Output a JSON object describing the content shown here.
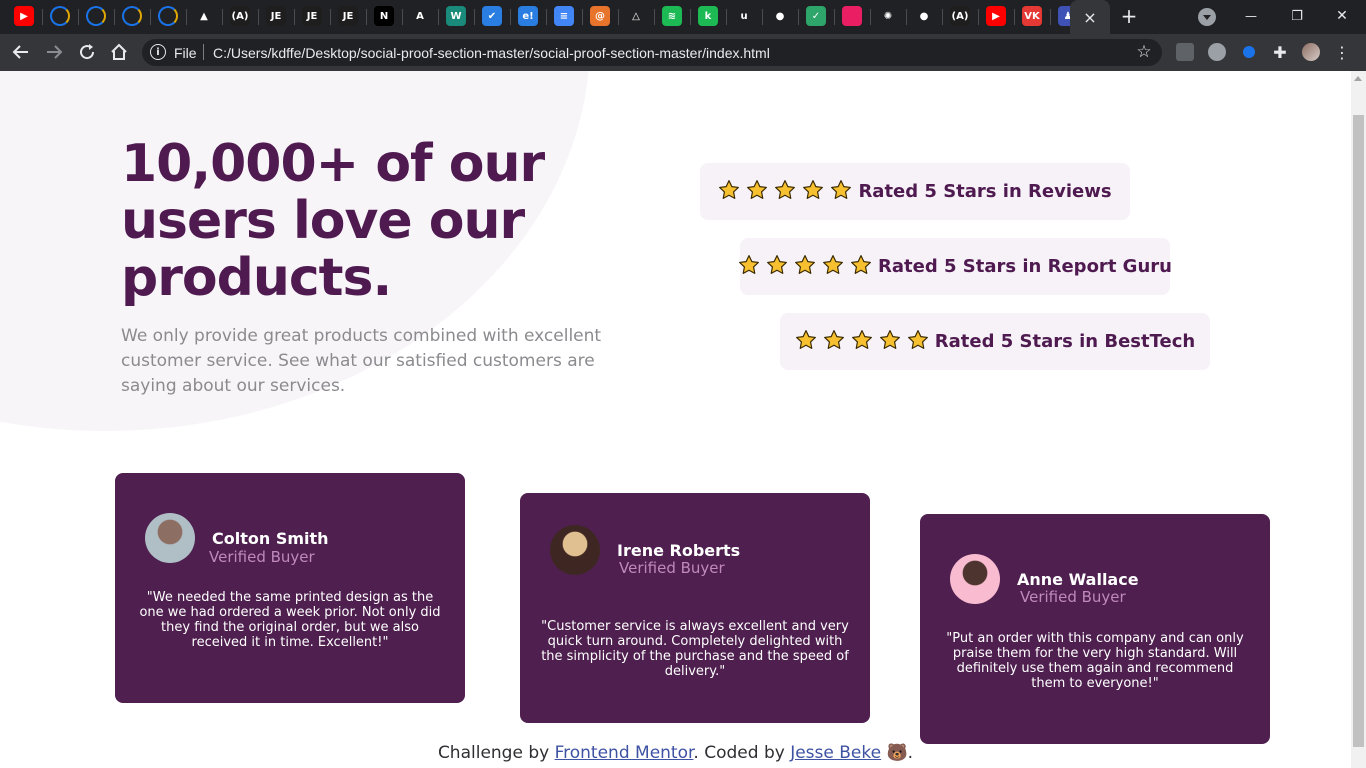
{
  "browser": {
    "url": "C:/Users/kdffe/Desktop/social-proof-section-master/social-proof-section-master/index.html",
    "scheme_label": "File",
    "new_tab_glyph": "+",
    "close_tab_glyph": "×",
    "window_controls": {
      "minimize": "—",
      "restore": "❐",
      "close": "✕"
    },
    "tab_favicons": [
      {
        "name": "youtube",
        "color": "#ff0000",
        "glyph": "▶"
      },
      {
        "name": "loading-1",
        "color": "#202124",
        "glyph": ""
      },
      {
        "name": "loading-2",
        "color": "#202124",
        "glyph": ""
      },
      {
        "name": "loading-3",
        "color": "#202124",
        "glyph": ""
      },
      {
        "name": "loading-4",
        "color": "#202124",
        "glyph": ""
      },
      {
        "name": "vercel",
        "color": "#202124",
        "glyph": "▲"
      },
      {
        "name": "devdocs",
        "color": "#1e1e1e",
        "glyph": "(A)"
      },
      {
        "name": "je-1",
        "color": "#1e1e1e",
        "glyph": "JE"
      },
      {
        "name": "je-2",
        "color": "#1e1e1e",
        "glyph": "JE"
      },
      {
        "name": "je-3",
        "color": "#1e1e1e",
        "glyph": "JE"
      },
      {
        "name": "nextjs",
        "color": "#000000",
        "glyph": "N"
      },
      {
        "name": "arch",
        "color": "#202124",
        "glyph": "A"
      },
      {
        "name": "w-site",
        "color": "#1a8a7a",
        "glyph": "W"
      },
      {
        "name": "todo",
        "color": "#2a7de1",
        "glyph": "✔"
      },
      {
        "name": "e-site",
        "color": "#2a7de1",
        "glyph": "e!"
      },
      {
        "name": "docs",
        "color": "#4285f4",
        "glyph": "≡"
      },
      {
        "name": "orange",
        "color": "#e8742c",
        "glyph": "@"
      },
      {
        "name": "nuxt",
        "color": "#202124",
        "glyph": "△"
      },
      {
        "name": "spotify",
        "color": "#1db954",
        "glyph": "≋"
      },
      {
        "name": "k-site",
        "color": "#1db954",
        "glyph": "k"
      },
      {
        "name": "u-site",
        "color": "#202124",
        "glyph": "u"
      },
      {
        "name": "github-1",
        "color": "#202124",
        "glyph": "●"
      },
      {
        "name": "vue-school",
        "color": "#2ea66b",
        "glyph": "✓"
      },
      {
        "name": "pink",
        "color": "#e91e63",
        "glyph": ""
      },
      {
        "name": "sun",
        "color": "#202124",
        "glyph": "✺"
      },
      {
        "name": "github-2",
        "color": "#202124",
        "glyph": "●"
      },
      {
        "name": "devdocs-2",
        "color": "#1e1e1e",
        "glyph": "(A)"
      },
      {
        "name": "youtube-2",
        "color": "#ff0000",
        "glyph": "▶"
      },
      {
        "name": "vk",
        "color": "#e53935",
        "glyph": "VK"
      },
      {
        "name": "octo",
        "color": "#3f51b5",
        "glyph": "♟"
      }
    ]
  },
  "hero": {
    "title": "10,000+ of our users love our products.",
    "description": "We only provide great products combined with excellent customer service. See what our satisfied customers are saying about our services."
  },
  "ratings": [
    {
      "label": "Rated 5 Stars in Reviews",
      "stars": 5
    },
    {
      "label": "Rated 5 Stars in Report Guru",
      "stars": 5
    },
    {
      "label": "Rated 5 Stars in BestTech",
      "stars": 5
    }
  ],
  "testimonials": [
    {
      "name": "Colton Smith",
      "role": "Verified Buyer",
      "quote": "\"We needed the same printed design as the one we had ordered a week prior. Not only did they find the original order, but we also received it in time. Excellent!\""
    },
    {
      "name": "Irene Roberts",
      "role": "Verified Buyer",
      "quote": "\"Customer service is always excellent and very quick turn around. Completely delighted with the simplicity of the purchase and the speed of delivery.\""
    },
    {
      "name": "Anne Wallace",
      "role": "Verified Buyer",
      "quote": "\"Put an order with this company and can only praise them for the very high standard. Will definitely use them again and recommend them to everyone!\""
    }
  ],
  "footer": {
    "prefix": "Challenge by",
    "link1": "Frontend Mentor",
    "middle": ". Coded by",
    "link2": "Jesse Beke",
    "suffix": "🐻."
  },
  "colors": {
    "brand_purple": "#4e1a50",
    "card_bg": "#4e1f4f",
    "rating_bg": "#f7f2f8",
    "star": "#f7c030",
    "role": "#c089be"
  }
}
